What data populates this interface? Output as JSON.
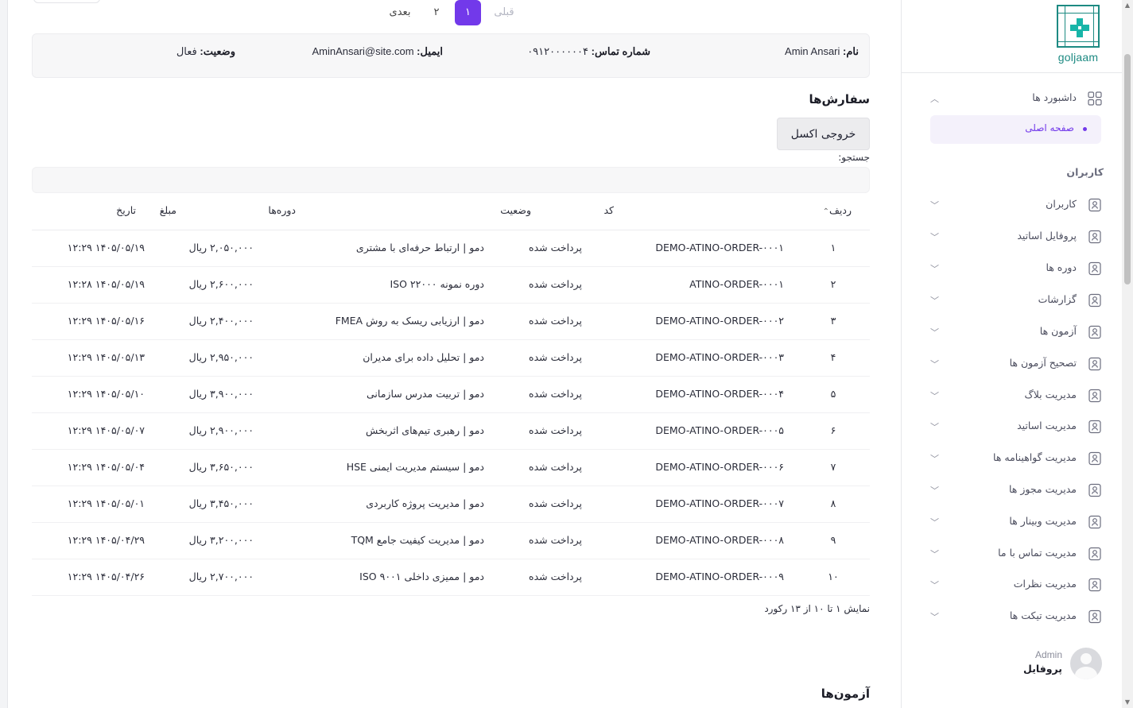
{
  "customer": {
    "name_label": "نام:",
    "name_value": "Amin Ansari",
    "phone_label": "شماره تماس:",
    "phone_value": "۰۹۱۲۰۰۰۰۰۰۴",
    "email_label": "ایمیل:",
    "email_value": "AminAnsari@site.com",
    "status_label": "وضعیت:",
    "status_value": "فعال"
  },
  "orders": {
    "title": "سفارش‌ها",
    "export_label": "خروجی اکسل",
    "search_label": "جستجو:",
    "search_value": "",
    "columns": {
      "row": "ردیف",
      "code": "کد",
      "status": "وضعیت",
      "courses": "دوره‌ها",
      "amount": "مبلغ",
      "date": "تاریخ"
    },
    "rows": [
      {
        "n": "۱",
        "code": "DEMO-ATINO-ORDER-۰۰۰۱",
        "status": "پرداخت شده",
        "course": "دمو | ارتباط حرفه‌ای با مشتری",
        "amount": "۲,۰۵۰,۰۰۰ ریال",
        "date": "۱۴۰۵/۰۵/۱۹ ۱۲:۲۹"
      },
      {
        "n": "۲",
        "code": "ATINO-ORDER-۰۰۰۱",
        "status": "پرداخت شده",
        "course": "دوره نمونه ISO ۲۲۰۰۰",
        "amount": "۲,۶۰۰,۰۰۰ ریال",
        "date": "۱۴۰۵/۰۵/۱۹ ۱۲:۲۸"
      },
      {
        "n": "۳",
        "code": "DEMO-ATINO-ORDER-۰۰۰۲",
        "status": "پرداخت شده",
        "course": "دمو | ارزیابی ریسک به روش FMEA",
        "amount": "۲,۴۰۰,۰۰۰ ریال",
        "date": "۱۴۰۵/۰۵/۱۶ ۱۲:۲۹"
      },
      {
        "n": "۴",
        "code": "DEMO-ATINO-ORDER-۰۰۰۳",
        "status": "پرداخت شده",
        "course": "دمو | تحلیل داده برای مدیران",
        "amount": "۲,۹۵۰,۰۰۰ ریال",
        "date": "۱۴۰۵/۰۵/۱۳ ۱۲:۲۹"
      },
      {
        "n": "۵",
        "code": "DEMO-ATINO-ORDER-۰۰۰۴",
        "status": "پرداخت شده",
        "course": "دمو | تربیت مدرس سازمانی",
        "amount": "۳,۹۰۰,۰۰۰ ریال",
        "date": "۱۴۰۵/۰۵/۱۰ ۱۲:۲۹"
      },
      {
        "n": "۶",
        "code": "DEMO-ATINO-ORDER-۰۰۰۵",
        "status": "پرداخت شده",
        "course": "دمو | رهبری تیم‌های اثربخش",
        "amount": "۲,۹۰۰,۰۰۰ ریال",
        "date": "۱۴۰۵/۰۵/۰۷ ۱۲:۲۹"
      },
      {
        "n": "۷",
        "code": "DEMO-ATINO-ORDER-۰۰۰۶",
        "status": "پرداخت شده",
        "course": "دمو | سیستم مدیریت ایمنی HSE",
        "amount": "۳,۶۵۰,۰۰۰ ریال",
        "date": "۱۴۰۵/۰۵/۰۴ ۱۲:۲۹"
      },
      {
        "n": "۸",
        "code": "DEMO-ATINO-ORDER-۰۰۰۷",
        "status": "پرداخت شده",
        "course": "دمو | مدیریت پروژه کاربردی",
        "amount": "۳,۴۵۰,۰۰۰ ریال",
        "date": "۱۴۰۵/۰۵/۰۱ ۱۲:۲۹"
      },
      {
        "n": "۹",
        "code": "DEMO-ATINO-ORDER-۰۰۰۸",
        "status": "پرداخت شده",
        "course": "دمو | مدیریت کیفیت جامع TQM",
        "amount": "۳,۲۰۰,۰۰۰ ریال",
        "date": "۱۴۰۵/۰۴/۲۹ ۱۲:۲۹"
      },
      {
        "n": "۱۰",
        "code": "DEMO-ATINO-ORDER-۰۰۰۹",
        "status": "پرداخت شده",
        "course": "دمو | ممیزی داخلی ISO ۹۰۰۱",
        "amount": "۲,۷۰۰,۰۰۰ ریال",
        "date": "۱۴۰۵/۰۴/۲۶ ۱۲:۲۹"
      }
    ],
    "info_text": "نمایش ۱ تا ۱۰ از ۱۳ رکورد",
    "pagination": {
      "prev": "قبلی",
      "page1": "۱",
      "page2": "۲",
      "next": "بعدی"
    }
  },
  "exams_title": "آزمون‌ها",
  "sidebar": {
    "logo_text": "goljaam",
    "dashboards_label": "داشبورد ها",
    "home_label": "صفحه اصلی",
    "section_users": "کاربران",
    "items": [
      "کاربران",
      "پروفایل اساتید",
      "دوره ها",
      "گزارشات",
      "آزمون ها",
      "تصحیح آزمون ها",
      "مدیریت بلاگ",
      "مدیریت اساتید",
      "مدیریت گواهینامه ها",
      "مدیریت مجوز ها",
      "مدیریت وبینار ها",
      "مدیریت تماس با ما",
      "مدیریت نظرات",
      "مدیریت تیکت ها"
    ],
    "profile_name": "Admin",
    "profile_link": "پروفایل"
  },
  "colors": {
    "accent": "#7239ea",
    "logo": "#1d8a82",
    "active_bg": "#f4f1fb"
  },
  "icons": {
    "dashboard": "grid-icon",
    "user": "user-card-icon",
    "chevron_up": "chevron-up-icon",
    "chevron_down": "chevron-down-icon",
    "sort": "sort-asc-icon"
  }
}
